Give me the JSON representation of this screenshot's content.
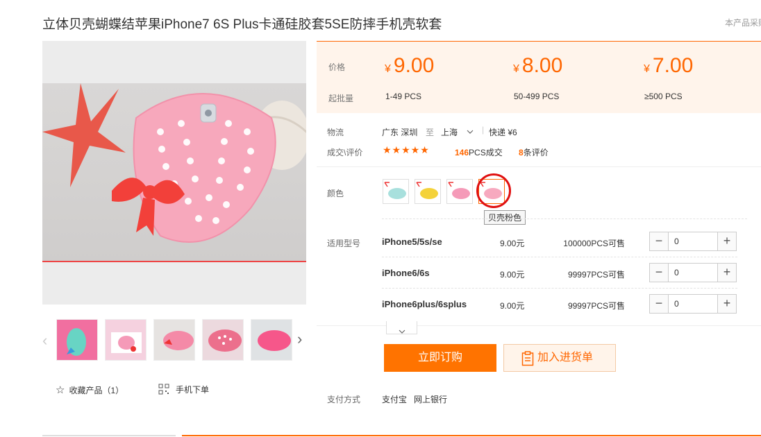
{
  "product": {
    "title": "立体贝壳蝴蝶结苹果iPhone7 6S Plus卡通硅胶套5SE防摔手机壳软套",
    "top_right_text": "本产品采购"
  },
  "price_panel": {
    "price_label": "价格",
    "batch_label": "起批量",
    "tiers": [
      {
        "currency": "¥",
        "price": "9.00",
        "range": "1-49 PCS"
      },
      {
        "currency": "¥",
        "price": "8.00",
        "range": "50-499 PCS"
      },
      {
        "currency": "¥",
        "price": "7.00",
        "range": "≥500 PCS"
      }
    ]
  },
  "logistics": {
    "label": "物流",
    "from": "广东 深圳",
    "to_word": "至",
    "to": "上海",
    "shipping": "快递 ¥6"
  },
  "deals": {
    "label": "成交\\评价",
    "stars": "★★★★★",
    "sold_count": "146",
    "sold_suffix": "PCS成交",
    "review_count": "8",
    "review_suffix": "条评价"
  },
  "color": {
    "label": "颜色",
    "tooltip": "贝壳粉色",
    "swatch_colors": [
      "#a8e0dd",
      "#f4d23a",
      "#f59ab8",
      "#f7a9bf"
    ]
  },
  "models": {
    "label": "适用型号",
    "rows": [
      {
        "name": "iPhone5/5s/se",
        "price": "9.00元",
        "stock": "100000",
        "stock_suffix": "PCS可售",
        "qty": "0"
      },
      {
        "name": "iPhone6/6s",
        "price": "9.00元",
        "stock": "99997",
        "stock_suffix": "PCS可售",
        "qty": "0"
      },
      {
        "name": "iPhone6plus/6splus",
        "price": "9.00元",
        "stock": "99997",
        "stock_suffix": "PCS可售",
        "qty": "0"
      }
    ]
  },
  "actions": {
    "buy_now": "立即订购",
    "add_to_cart": "加入进货单"
  },
  "payment": {
    "label": "支付方式",
    "methods": [
      "支付宝",
      "网上银行"
    ]
  },
  "gallery": {
    "favorite_label": "收藏产品（1）",
    "mobile_order_label": "手机下单",
    "thumbnail_colors": [
      "#f16fa0",
      "#f5d1df",
      "#f48aa7",
      "#ec6f8c",
      "#f6578a"
    ]
  },
  "colors": {
    "accent": "#ff6600",
    "panel_bg": "#fff4eb",
    "case_pink": "#f7a8bc",
    "bow_red": "#f2403a"
  }
}
